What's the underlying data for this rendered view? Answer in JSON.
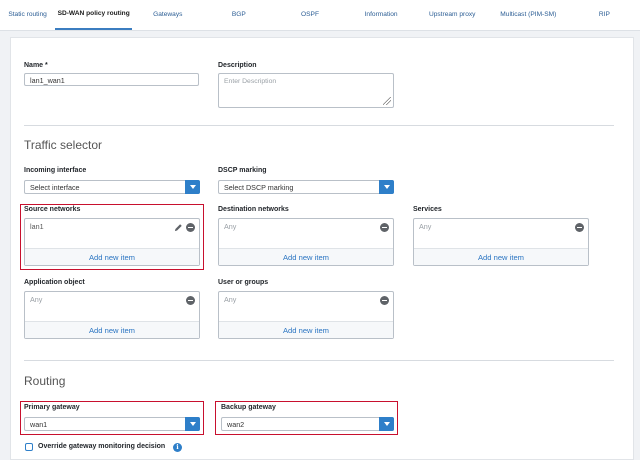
{
  "tabs": [
    {
      "label": "Static routing"
    },
    {
      "label": "SD-WAN policy routing",
      "active": true
    },
    {
      "label": "Gateways"
    },
    {
      "label": "BGP"
    },
    {
      "label": "OSPF"
    },
    {
      "label": "Information"
    },
    {
      "label": "Upstream proxy"
    },
    {
      "label": "Multicast (PIM-SM)"
    },
    {
      "label": "RIP"
    }
  ],
  "name": {
    "label": "Name *",
    "value": "lan1_wan1"
  },
  "description": {
    "label": "Description",
    "placeholder": "Enter Description"
  },
  "traffic_selector": {
    "title": "Traffic selector",
    "incoming_interface": {
      "label": "Incoming interface",
      "value": "Select interface"
    },
    "dscp_marking": {
      "label": "DSCP marking",
      "value": "Select DSCP marking"
    },
    "source_networks": {
      "label": "Source networks",
      "value": "lan1",
      "add": "Add new item"
    },
    "destination_networks": {
      "label": "Destination networks",
      "value": "Any",
      "add": "Add new item"
    },
    "services": {
      "label": "Services",
      "value": "Any",
      "add": "Add new item"
    },
    "application_object": {
      "label": "Application object",
      "value": "Any",
      "add": "Add new item"
    },
    "user_or_groups": {
      "label": "User or groups",
      "value": "Any",
      "add": "Add new item"
    }
  },
  "routing": {
    "title": "Routing",
    "primary_gateway": {
      "label": "Primary gateway",
      "value": "wan1"
    },
    "backup_gateway": {
      "label": "Backup gateway",
      "value": "wan2"
    },
    "override_label": "Override gateway monitoring decision",
    "override_checked": false
  },
  "colors": {
    "accent": "#2e7fc9",
    "highlight": "#c8102e",
    "link": "#2b75c2"
  },
  "icons": {
    "remove": "minus-circle-icon",
    "edit": "pencil-icon",
    "dropdown": "chevron-down-icon",
    "info": "info-icon"
  }
}
